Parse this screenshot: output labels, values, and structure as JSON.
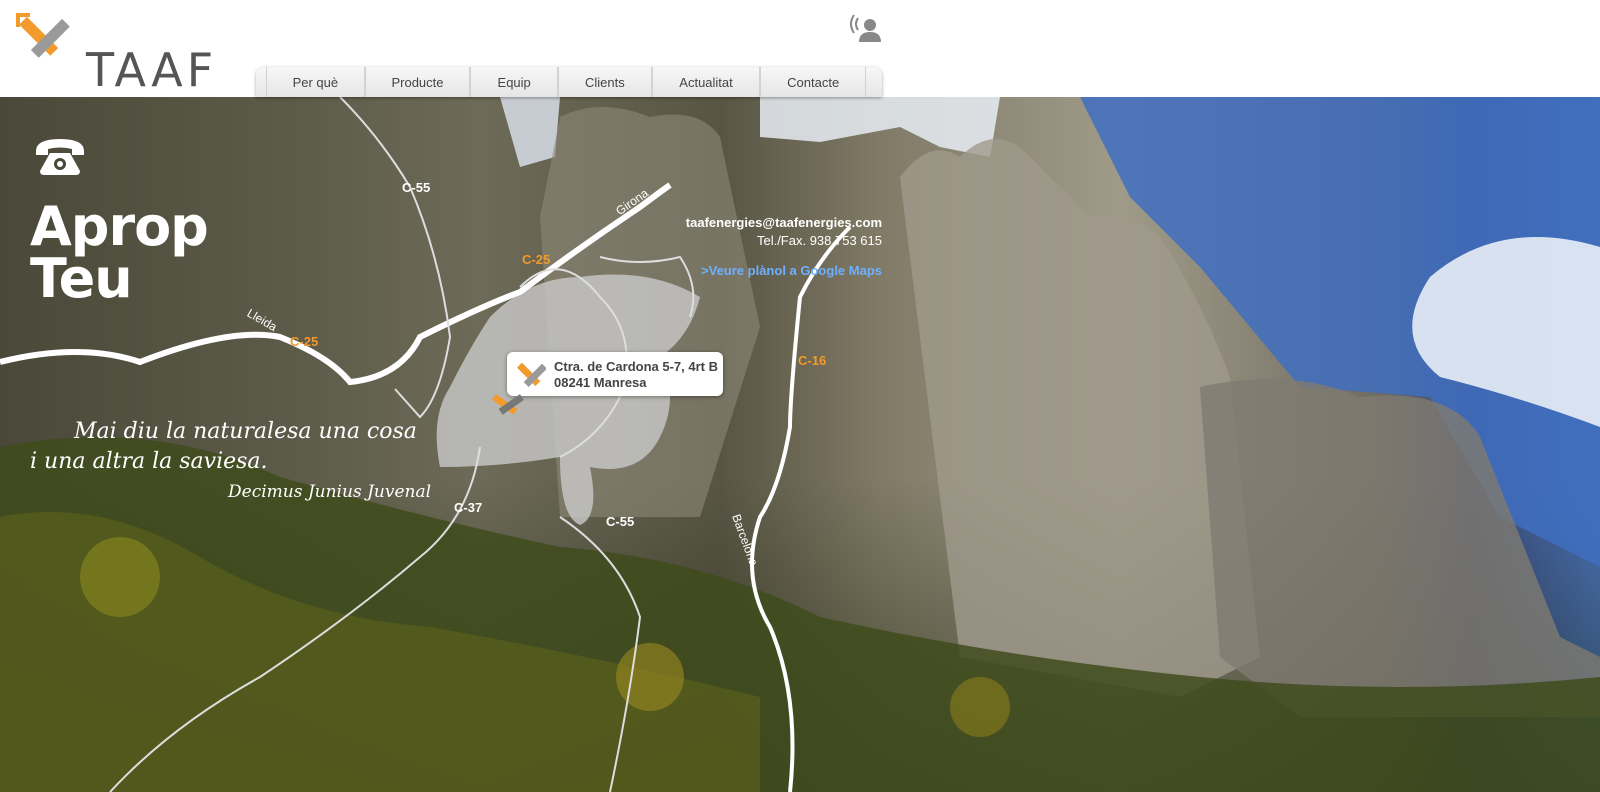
{
  "brand": {
    "logo_text": "TAAF",
    "accent": "#f39a2c",
    "gray": "#8a8a8a"
  },
  "header": {
    "contact_icon": "person-broadcast-icon"
  },
  "nav": {
    "items": [
      {
        "label": "Per què"
      },
      {
        "label": "Producte"
      },
      {
        "label": "Equip"
      },
      {
        "label": "Clients"
      },
      {
        "label": "Actualitat"
      },
      {
        "label": "Contacte"
      }
    ]
  },
  "hero": {
    "phone_icon": "telephone-icon",
    "headline_line1": "Aprop",
    "headline_line2": "Teu",
    "quote_line1": "Mai diu la naturalesa una cosa",
    "quote_line2": "i una altra la saviesa.",
    "quote_author": "Decimus Junius Juvenal"
  },
  "contact": {
    "email": "taafenergies@taafenergies.com",
    "tel": "Tel./Fax. 938 753 615",
    "maps_link": ">Veure plànol a Google Maps"
  },
  "address": {
    "line1": "Ctra. de Cardona 5-7, 4rt B",
    "line2": "08241 Manresa"
  },
  "map": {
    "roads": {
      "c55_north": "C-55",
      "c25_north": "C-25",
      "c25_west": "C-25",
      "c16": "C-16",
      "c37": "C-37",
      "c55_south": "C-55"
    },
    "directions": {
      "girona": "Girona",
      "lleida": "Lleida",
      "barcelona": "Barcelona"
    }
  }
}
